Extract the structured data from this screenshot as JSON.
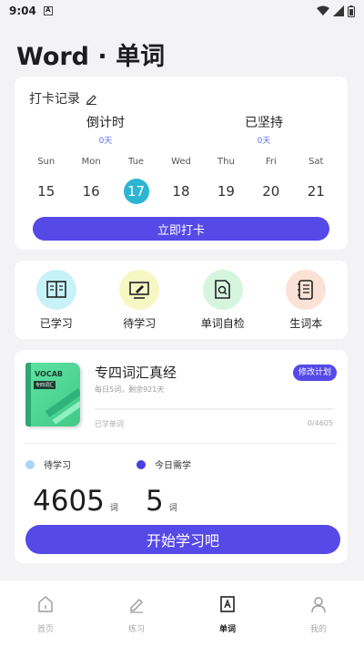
{
  "status_bar": {
    "time": "9:04",
    "notif_glyph": "A"
  },
  "app": {
    "title": "Word · 单词"
  },
  "checkin": {
    "title": "打卡记录",
    "countdown_label": "倒计时",
    "countdown_value": "0天",
    "streak_label": "已坚持",
    "streak_value": "0天",
    "week": [
      {
        "name": "Sun",
        "date": "15"
      },
      {
        "name": "Mon",
        "date": "16"
      },
      {
        "name": "Tue",
        "date": "17"
      },
      {
        "name": "Wed",
        "date": "18"
      },
      {
        "name": "Thu",
        "date": "19"
      },
      {
        "name": "Fri",
        "date": "20"
      },
      {
        "name": "Sat",
        "date": "21"
      }
    ],
    "active_day": 2,
    "button": "立即打卡"
  },
  "tools": [
    {
      "label": "已学习",
      "icon": "book-open-icon",
      "bg": "#c7f2f7"
    },
    {
      "label": "待学习",
      "icon": "monitor-pen-icon",
      "bg": "#f7f7c4"
    },
    {
      "label": "单词自检",
      "icon": "document-search-icon",
      "bg": "#d5f5df"
    },
    {
      "label": "生词本",
      "icon": "notebook-icon",
      "bg": "#fbe2d6"
    }
  ],
  "plan": {
    "book_title": "VOCAB",
    "book_subtitle": "专四词汇",
    "title": "专四词汇真经",
    "subtitle": "每日5词，剩余921天",
    "edit_button": "修改计划",
    "progress_label": "已学单词",
    "progress_count": "0/4605",
    "progress_fraction": 0,
    "legend_pending": "待学习",
    "legend_today": "今日需学",
    "pending_count": "4605",
    "today_count": "5",
    "unit": "词",
    "start_button": "开始学习吧"
  },
  "nav": [
    {
      "label": "首页",
      "icon": "home-icon"
    },
    {
      "label": "练习",
      "icon": "pencil-icon"
    },
    {
      "label": "单词",
      "icon": "word-book-icon"
    },
    {
      "label": "我的",
      "icon": "user-icon"
    }
  ],
  "nav_active": 2,
  "colors": {
    "accent": "#5549e8",
    "active_day": "#2cb5d2",
    "legend_pending": "#a9d6f5",
    "legend_today": "#4a3fe0"
  }
}
